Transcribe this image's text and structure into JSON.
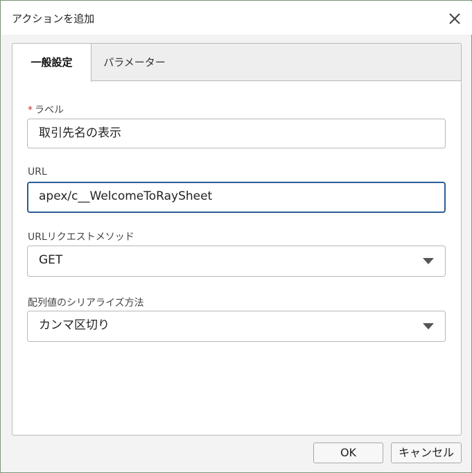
{
  "dialog": {
    "title": "アクションを追加",
    "close_icon": "close-icon"
  },
  "tabs": [
    {
      "label": "一般設定",
      "active": true
    },
    {
      "label": "パラメーター",
      "active": false
    }
  ],
  "form": {
    "label_field": {
      "required_mark": "*",
      "label": "ラベル",
      "value": "取引先名の表示"
    },
    "url_field": {
      "label": "URL",
      "value": "apex/c__WelcomeToRaySheet"
    },
    "method_field": {
      "label": "URLリクエストメソッド",
      "selected": "GET"
    },
    "serialize_field": {
      "label": "配列値のシリアライズ方法",
      "selected": "カンマ区切り"
    }
  },
  "footer": {
    "ok_label": "OK",
    "cancel_label": "キャンセル"
  },
  "colors": {
    "focus_border": "#2c5c96",
    "required": "#c23934"
  }
}
